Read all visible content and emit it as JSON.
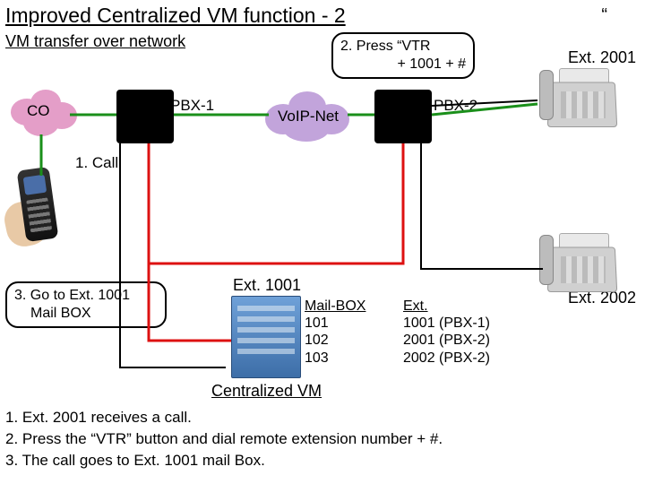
{
  "title": "Improved Centralized VM function - 2",
  "quote": "“",
  "subtitle": "VM transfer over network",
  "labels": {
    "co": "CO",
    "pbx1": "PBX-1",
    "pbx2": "PBX-2",
    "voip": "VoIP-Net",
    "ext2001": "Ext. 2001",
    "ext2002": "Ext. 2002",
    "call": "1. Call",
    "step2_line1": "2. Press “VTR",
    "step2_line2": "+ 1001 + #",
    "step3_line1": "3. Go to Ext. 1001",
    "step3_line2": "Mail BOX",
    "ext1001": "Ext. 1001",
    "cvm": "Centralized VM"
  },
  "mailbox": {
    "header": "Mail-BOX",
    "rows": [
      "101",
      "102",
      "103"
    ]
  },
  "extmap": {
    "header": "Ext.",
    "rows": [
      "1001 (PBX-1)",
      "2001 (PBX-2)",
      "2002 (PBX-2)"
    ]
  },
  "steps": {
    "s1": "1. Ext. 2001 receives a call.",
    "s2": "2. Press the “VTR” button and dial remote extension number + #.",
    "s3": "3. The call goes to Ext. 1001 mail Box."
  }
}
